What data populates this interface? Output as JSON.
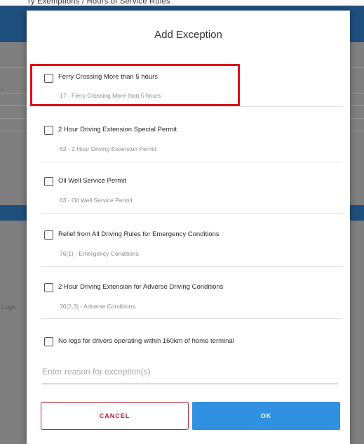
{
  "background": {
    "caption": "ry Exemptions / Hours of Service Rules",
    "left_text_1": "i",
    "left_text_2": "Logs"
  },
  "dialog": {
    "title": "Add Exception",
    "options": [
      {
        "label": "Ferry Crossing More than 5 hours",
        "sub": "17 - Ferry Crossing More than 5 hours",
        "checked": false
      },
      {
        "label": "2 Hour Driving Extension Special Permit",
        "sub": "62 - 2 Hour Driving Extension Permit",
        "checked": false
      },
      {
        "label": "Oil Well Service Permit",
        "sub": "63 - Oil Well Service Permit",
        "checked": false
      },
      {
        "label": "Relief from All Driving Rules for Emergency Conditions",
        "sub": "76(1) - Emergency Conditions",
        "checked": false
      },
      {
        "label": "2 Hour Driving Extension for Adverse Driving Conditions",
        "sub": "76(2,3) - Adverse Conditions",
        "checked": false
      },
      {
        "label": "No logs for drivers operating within 160km of home terminal",
        "checked": false
      }
    ],
    "reason_placeholder": "Enter reason for exception(s)",
    "reason_value": "",
    "cancel_label": "CANCEL",
    "ok_label": "OK"
  },
  "colors": {
    "highlight": "#e00d1a",
    "primary": "#2f91e0",
    "cancel": "#b5222e",
    "app_bar": "#1f4f7d"
  },
  "icons": {
    "checkbox": "checkbox-unchecked-icon"
  }
}
